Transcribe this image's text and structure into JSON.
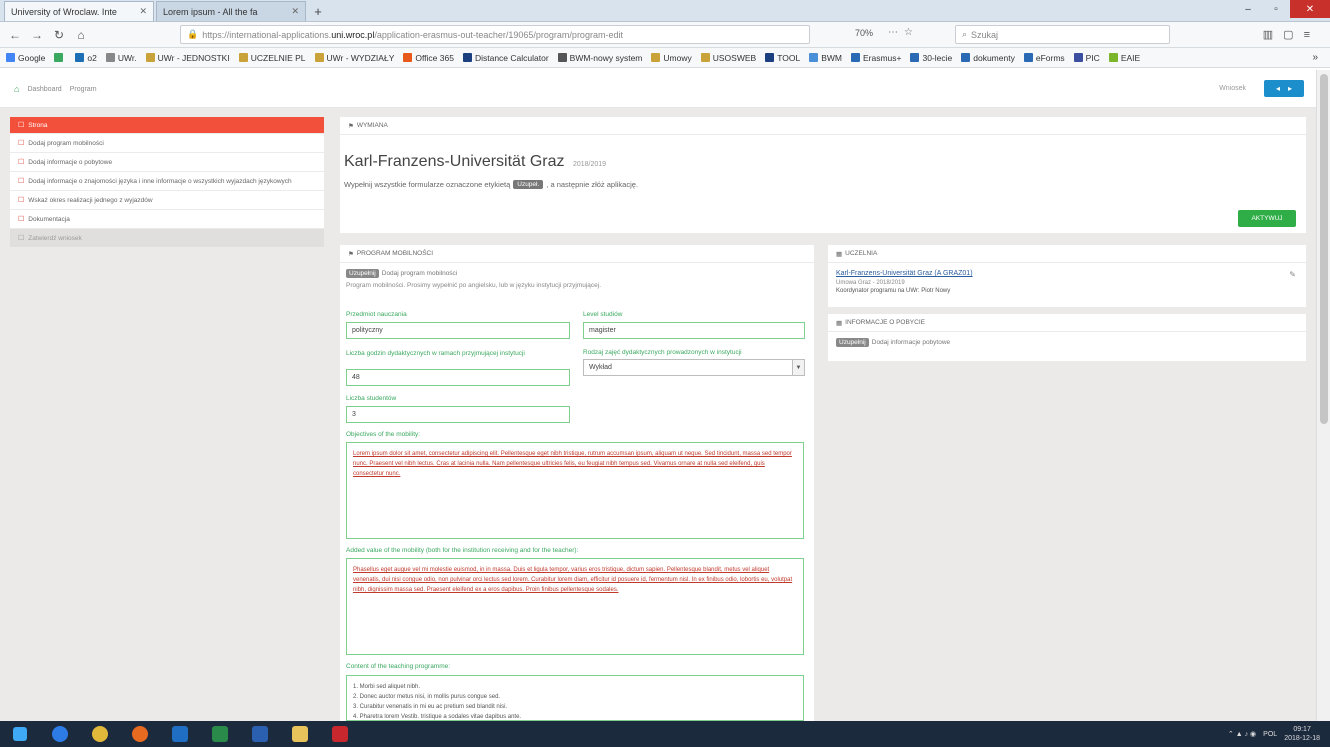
{
  "browser": {
    "tabs": [
      {
        "label": "University of Wroclaw. Inte",
        "active": true
      },
      {
        "label": "Lorem ipsum - All the fa",
        "active": false
      }
    ],
    "url_prefix": "https://international-applications.",
    "url_domain": "uni.wroc.pl",
    "url_suffix": "/application-erasmus-out-teacher/19065/program/program-edit",
    "zoom": "70%",
    "search_placeholder": "Szukaj",
    "bookmarks": [
      {
        "label": "Google",
        "color": "#4285f4"
      },
      {
        "label": "",
        "color": "#3aa85f"
      },
      {
        "label": "o2",
        "color": "#1c6fb5"
      },
      {
        "label": "UWr.",
        "color": "#888888"
      },
      {
        "label": "UWr - JEDNOSTKI",
        "color": "#c9a33a"
      },
      {
        "label": "UCZELNIE PL",
        "color": "#c9a33a"
      },
      {
        "label": "UWr - WYDZIAŁY",
        "color": "#c9a33a"
      },
      {
        "label": "Office 365",
        "color": "#e8581a"
      },
      {
        "label": "Distance Calculator",
        "color": "#1c3f7f"
      },
      {
        "label": "BWM-nowy system",
        "color": "#555555"
      },
      {
        "label": "Umowy",
        "color": "#c9a33a"
      },
      {
        "label": "USOSWEB",
        "color": "#c9a33a"
      },
      {
        "label": "TOOL",
        "color": "#1c3f7f"
      },
      {
        "label": "BWM",
        "color": "#4a90d9"
      },
      {
        "label": "Erasmus+",
        "color": "#2a6ab5"
      },
      {
        "label": "30-lecie",
        "color": "#2a6ab5"
      },
      {
        "label": "dokumenty",
        "color": "#2a6ab5"
      },
      {
        "label": "eForms",
        "color": "#2a6ab5"
      },
      {
        "label": "PIC",
        "color": "#3b4ea0"
      },
      {
        "label": "EAIE",
        "color": "#7ab52a"
      }
    ]
  },
  "app": {
    "breadcrumb": [
      "Dashboard",
      "Program"
    ],
    "user_label": "Wniosek",
    "sidebar": [
      {
        "label": "Strona",
        "state": "active"
      },
      {
        "label": "Dodaj program mobilności",
        "state": "normal"
      },
      {
        "label": "Dodaj informacje o pobytowe",
        "state": "normal"
      },
      {
        "label": "Dodaj informacje o znajomości języka i inne informacje o wszystkich wyjazdach językowych",
        "state": "normal"
      },
      {
        "label": "Wskaż okres realizacji jednego z wyjazdów",
        "state": "normal"
      },
      {
        "label": "Dokumentacja",
        "state": "normal"
      },
      {
        "label": "Zatwierdź wniosek",
        "state": "disabled"
      }
    ],
    "header": {
      "caption": "Wymiana",
      "title": "Karl-Franzens-Universität Graz",
      "year": "2018/2019",
      "desc_before": "Wypełnij wszystkie formularze oznaczone etykietą",
      "desc_pill": "Uzupeł.",
      "desc_after": ", a następnie złóż aplikację.",
      "activate_label": "AKTYWUJ"
    },
    "form": {
      "caption": "Program mobilności",
      "note_pill": "Uzupełnij",
      "note_text": "Dodaj program mobilności",
      "note2": "Program mobilności. Prosimy wypełnić po angielsku, lub w języku instytucji przyjmującej.",
      "fields": {
        "subject_label": "Przedmiot nauczania",
        "subject_value": "polityczny",
        "level_label": "Level studiów",
        "level_value": "magister",
        "hours_label": "Liczba godzin dydaktycznych w ramach przyjmującej instytucji",
        "hours_value": "48",
        "type_label": "Rodzaj zajęć dydaktycznych prowadzonych w instytucji",
        "type_value": "Wykład",
        "students_label": "Liczba studentów",
        "students_value": "3"
      },
      "objectives_label": "Objectives of the mobility:",
      "objectives_text": "Lorem ipsum dolor sit amet, consectetur adipiscing elit. Pellentesque eget nibh tristique, rutrum accumsan ipsum, aliquam ut neque. Sed tincidunt, massa sed tempor nunc. Praesent vel nibh lectus. Cras at lacinia nulla. Nam pellentesque ultricies felis, eu feugiat nibh tempus sed. Vivamus ornare at nulla sed eleifend, quis consectetur nunc.",
      "added_value_label": "Added value of the mobility (both for the institution receiving and for the teacher):",
      "added_value_text": "Phasellus eget augue vel mi molestie euismod, in in massa. Duis et ligula tempor, varius eros tristique, dictum sapien. Pellentesque blandit, metus vel aliquet venenatis, dui nisi congue odio, non pulvinar orci lectus sed lorem. Curabitur lorem diam, efficitur id posuere id, fermentum nisl. In ex finibus odio, lobortis eu, volutpat nibh, dignissim massa sed. Praesent eleifend ex a eros dapibus. Proin finibus pellentesque sodales.",
      "content_label": "Content of the teaching programme:",
      "content_items": [
        "1. Morbi sed aliquet nibh.",
        "2. Donec auctor metus nisi, in mollis purus congue sed.",
        "3. Curabitur venenatis in mi eu ac pretium sed blandit nisi.",
        "4. Pharetra lorem Vestib. tristique a sodales vitae dapibus ante."
      ]
    },
    "partner_card": {
      "caption": "Uczelnia",
      "link": "Karl-Franzens-Universität Graz (A GRAZ01)",
      "line1": "Umowa Graz - 2018/2019",
      "line2": "Koordynator programu na UWr: Piotr Nowy"
    },
    "info_card": {
      "caption": "Informacje o pobycie",
      "pill": "Uzupełnij",
      "text": "Dodaj informacje pobytowe"
    }
  },
  "taskbar": {
    "lang": "POL",
    "time": "09:17",
    "date": "2018-12-18"
  }
}
